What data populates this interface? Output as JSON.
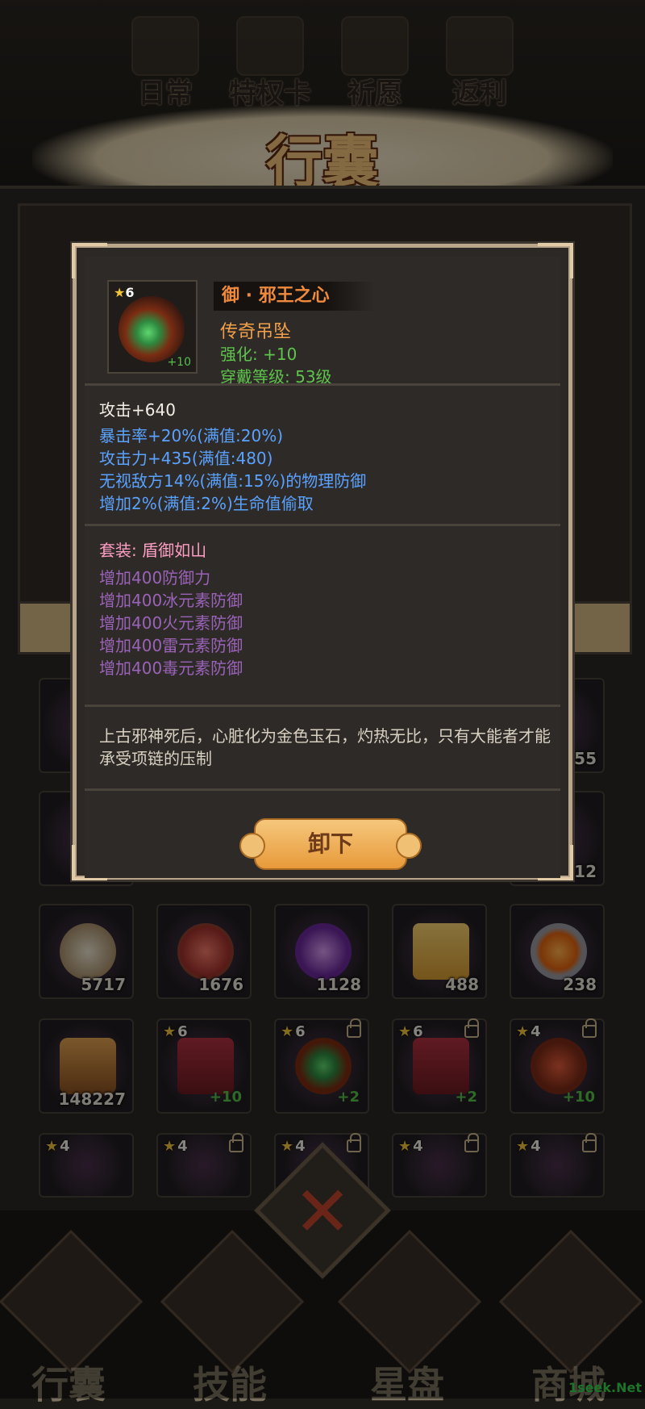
{
  "top_menu": {
    "items": [
      {
        "label": "日常"
      },
      {
        "label": "特权卡"
      },
      {
        "label": "祈愿"
      },
      {
        "label": "返利"
      }
    ],
    "title": "行囊"
  },
  "popup": {
    "item_name": "御 · 邪王之心",
    "item_type": "传奇吊坠",
    "enhance": "强化: +10",
    "wear_level": "穿戴等级: 53级",
    "icon_stars": "6",
    "icon_enhance": "+10",
    "base_stat": "攻击+640",
    "extra_stats": [
      "暴击率+20%(满值:20%)",
      "攻击力+435(满值:480)",
      "无视敌方14%(满值:15%)的物理防御",
      "增加2%(满值:2%)生命值偷取"
    ],
    "set_title": "套装: 盾御如山",
    "set_effects": [
      "增加400防御力",
      "增加400冰元素防御",
      "增加400火元素防御",
      "增加400雷元素防御",
      "增加400毒元素防御"
    ],
    "description": "上古邪神死后，心脏化为金色玉石，灼热无比，只有大能者才能承受项链的压制",
    "unequip_label": "卸下"
  },
  "inventory": {
    "row_counts": [
      "5717",
      "1676",
      "1128",
      "488",
      "238"
    ],
    "row2": [
      {
        "count": "148227"
      },
      {
        "stars": "6",
        "enhance": "+10"
      },
      {
        "stars": "6",
        "enhance": "+2"
      },
      {
        "stars": "6",
        "enhance": "+2"
      },
      {
        "stars": "4",
        "enhance": "+10"
      }
    ],
    "row3_stars": [
      "4",
      "4",
      "4",
      "4",
      "4"
    ],
    "partial_counts": [
      "55",
      "12"
    ]
  },
  "bottom_nav": {
    "items": [
      {
        "label": "行囊"
      },
      {
        "label": "技能"
      },
      {
        "label": "星盘"
      },
      {
        "label": "商城"
      }
    ]
  },
  "watermark": "1seek.Net",
  "colors": {
    "accent_orange": "#f08a3c",
    "enhance_green": "#5ec44c",
    "stat_blue": "#5aa2ff",
    "set_purple": "#9a63b8",
    "set_title_pink": "#ff9ec4",
    "close_red": "#c0452c"
  }
}
